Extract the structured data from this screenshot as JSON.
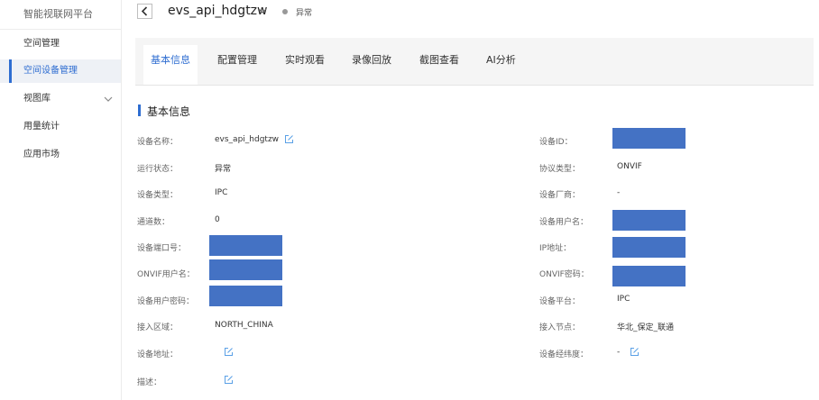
{
  "sidebar": {
    "title": "智能视联网平台",
    "items": [
      {
        "label": "空间管理"
      },
      {
        "label": "空间设备管理"
      },
      {
        "label": "视图库"
      },
      {
        "label": "用量统计"
      },
      {
        "label": "应用市场"
      }
    ]
  },
  "header": {
    "device_name": "evs_api_hdgtzw",
    "status": "异常"
  },
  "tabs": [
    {
      "label": "基本信息"
    },
    {
      "label": "配置管理"
    },
    {
      "label": "实时观看"
    },
    {
      "label": "录像回放"
    },
    {
      "label": "截图查看"
    },
    {
      "label": "AI分析"
    }
  ],
  "section": {
    "title": "基本信息"
  },
  "fields_left": [
    {
      "label": "设备名称：",
      "value": "evs_api_hdgtzw"
    },
    {
      "label": "运行状态：",
      "value": "异常"
    },
    {
      "label": "设备类型：",
      "value": "IPC"
    },
    {
      "label": "通道数：",
      "value": "0"
    },
    {
      "label": "设备端口号："
    },
    {
      "label": "ONVIF用户名："
    },
    {
      "label": "设备用户密码："
    },
    {
      "label": "接入区域：",
      "value": "NORTH_CHINA"
    },
    {
      "label": "设备地址："
    },
    {
      "label": "描述："
    }
  ],
  "fields_right": [
    {
      "label": "设备ID："
    },
    {
      "label": "协议类型：",
      "value": "ONVIF"
    },
    {
      "label": "设备厂商：",
      "value": "-"
    },
    {
      "label": "设备用户名："
    },
    {
      "label": "IP地址："
    },
    {
      "label": "ONVIF密码："
    },
    {
      "label": "设备平台：",
      "value": "IPC"
    },
    {
      "label": "接入节点：",
      "value": "华北_保定_联通"
    },
    {
      "label": "设备经纬度：",
      "value": "-"
    }
  ],
  "colors": {
    "accent": "#2e6dd1",
    "redaction": "#4472c4",
    "edit_icon": "#5aa0e6"
  }
}
